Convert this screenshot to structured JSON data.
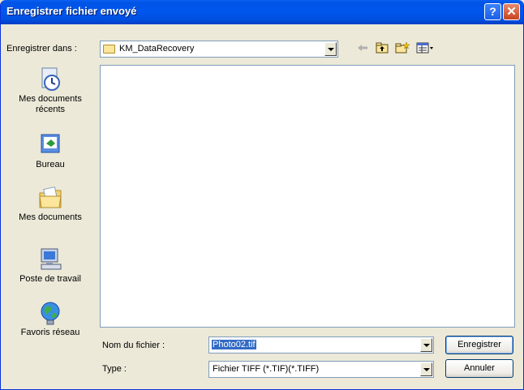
{
  "window": {
    "title": "Enregistrer fichier envoyé",
    "help_label": "?",
    "close_label": "✕"
  },
  "toolbar": {
    "save_in_label": "Enregistrer dans :",
    "location_value": "KM_DataRecovery",
    "back_icon": "back-arrow-icon",
    "up_icon": "up-folder-icon",
    "new_folder_icon": "new-folder-icon",
    "view_menu_icon": "view-menu-icon"
  },
  "places": [
    {
      "id": "recent",
      "label": "Mes documents récents",
      "icon": "recent-documents-icon"
    },
    {
      "id": "desktop",
      "label": "Bureau",
      "icon": "desktop-icon"
    },
    {
      "id": "documents",
      "label": "Mes documents",
      "icon": "my-documents-icon"
    },
    {
      "id": "computer",
      "label": "Poste de travail",
      "icon": "my-computer-icon"
    },
    {
      "id": "network",
      "label": "Favoris réseau",
      "icon": "network-places-icon"
    }
  ],
  "form": {
    "filename_label": "Nom du fichier :",
    "filename_value": "Photo02.tif",
    "type_label": "Type :",
    "type_value": "Fichier TIFF (*.TIF)(*.TIFF)"
  },
  "buttons": {
    "save": "Enregistrer",
    "cancel": "Annuler"
  },
  "colors": {
    "titlebar": "#0054e3",
    "dialog_bg": "#ece9d8",
    "selection": "#316ac5"
  }
}
